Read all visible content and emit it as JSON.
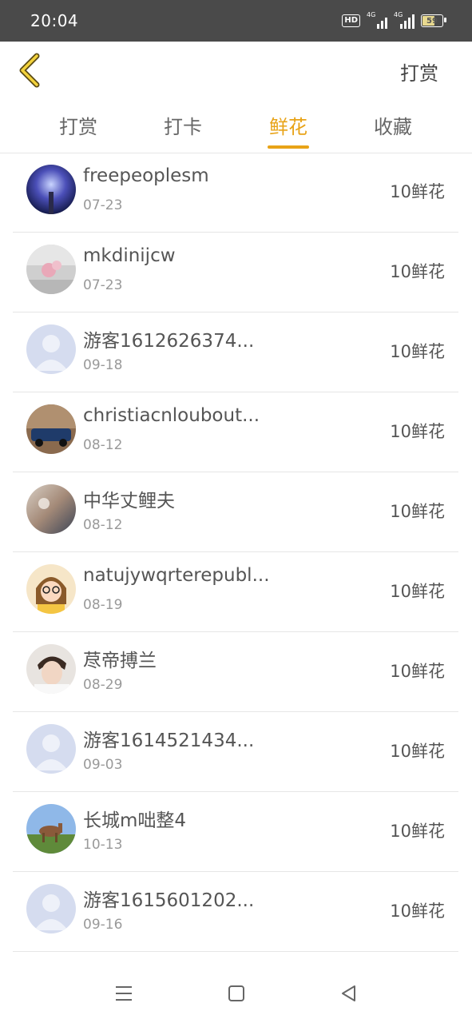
{
  "status_bar": {
    "time": "20:04",
    "hd_label": "HD",
    "signal1_label": "4G",
    "signal2_label": "4G",
    "battery": "59",
    "battery_level": 0.59
  },
  "header": {
    "back_icon": "chevron-left-icon",
    "title": "打赏"
  },
  "tabs": [
    {
      "label": "打赏",
      "active": false
    },
    {
      "label": "打卡",
      "active": false
    },
    {
      "label": "鲜花",
      "active": true
    },
    {
      "label": "收藏",
      "active": false
    }
  ],
  "accent_color": "#e8a317",
  "list": [
    {
      "name": "freepeoplesm",
      "date": "07-23",
      "amount": "10鲜花",
      "avatar": "photo-night-sky"
    },
    {
      "name": "mkdinijcw",
      "date": "07-23",
      "amount": "10鲜花",
      "avatar": "photo-pink-flower"
    },
    {
      "name": "游客1612626374...",
      "date": "09-18",
      "amount": "10鲜花",
      "avatar": "default-user"
    },
    {
      "name": "christiacnloubout...",
      "date": "08-12",
      "amount": "10鲜花",
      "avatar": "photo-car"
    },
    {
      "name": "中华丈鲤夫",
      "date": "08-12",
      "amount": "10鲜花",
      "avatar": "photo-blurry-room"
    },
    {
      "name": "natujywqrterepubl...",
      "date": "08-19",
      "amount": "10鲜花",
      "avatar": "cartoon-girl"
    },
    {
      "name": "荩帝搏兰",
      "date": "08-29",
      "amount": "10鲜花",
      "avatar": "photo-man"
    },
    {
      "name": "游客1614521434...",
      "date": "09-03",
      "amount": "10鲜花",
      "avatar": "default-user"
    },
    {
      "name": "长城m咄整4",
      "date": "10-13",
      "amount": "10鲜花",
      "avatar": "photo-horse"
    },
    {
      "name": "游客1615601202...",
      "date": "09-16",
      "amount": "10鲜花",
      "avatar": "default-user"
    },
    {
      "name": "",
      "date": "",
      "amount": "",
      "avatar": "default-user"
    }
  ],
  "nav_bar": {
    "menu_icon": "menu-icon",
    "home_icon": "home-square-icon",
    "back_icon": "back-triangle-icon"
  }
}
